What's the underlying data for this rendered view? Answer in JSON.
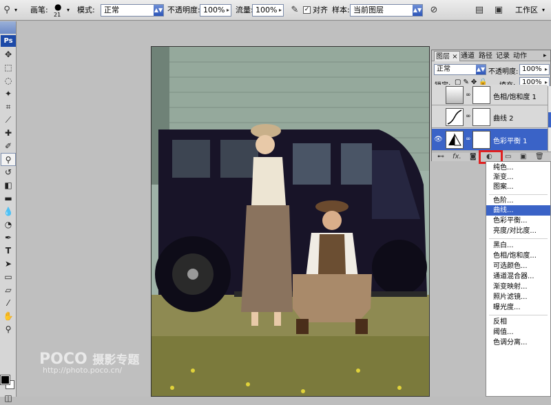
{
  "options_bar": {
    "brush_label": "画笔:",
    "brush_size": "21",
    "mode_label": "模式:",
    "mode_value": "正常",
    "opacity_label": "不透明度:",
    "opacity_value": "100%",
    "flow_label": "流量:",
    "flow_value": "100%",
    "aligned_label": "对齐",
    "sample_label": "样本:",
    "sample_value": "当前图层",
    "workspace_label": "工作区"
  },
  "toolbox": {
    "app_badge": "Ps"
  },
  "watermark": {
    "brand": "POCO",
    "title": "摄影专题",
    "url": "http://photo.poco.cn/"
  },
  "layers_panel": {
    "tabs": [
      "图层",
      "通道",
      "路径",
      "记录",
      "动作"
    ],
    "close_mark": "×",
    "blend_mode": "正常",
    "opacity_label": "不透明度:",
    "opacity_value": "100%",
    "lock_label": "锁定:",
    "fill_label": "填充:",
    "fill_value": "100%",
    "layers": [
      {
        "name": "色相/饱和度 1",
        "selected": false
      },
      {
        "name": "曲线 2",
        "selected": false
      },
      {
        "name": "色彩平衡 1",
        "selected": true
      }
    ]
  },
  "adjustment_menu": {
    "groups": [
      [
        "纯色...",
        "渐变...",
        "图案..."
      ],
      [
        "色阶...",
        "曲线...",
        "色彩平衡...",
        "亮度/对比度..."
      ],
      [
        "黑白...",
        "色相/饱和度...",
        "可选颜色...",
        "通道混合器...",
        "渐变映射...",
        "照片滤镜...",
        "曝光度..."
      ],
      [
        "反相",
        "阈值...",
        "色调分离..."
      ]
    ],
    "highlighted": "曲线..."
  },
  "colors": {
    "highlight": "#3a63c7",
    "callout": "#e02020"
  }
}
